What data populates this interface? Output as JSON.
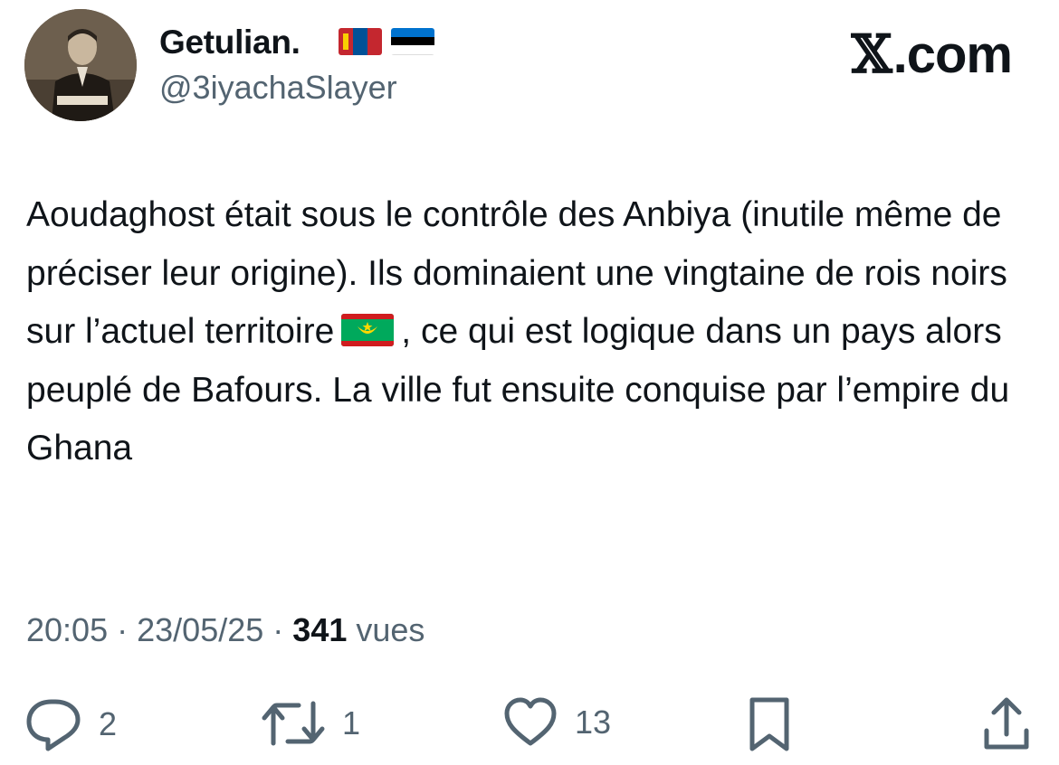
{
  "author": {
    "display_name": "Getulian.",
    "handle": "@3iyachaSlayer",
    "flags": [
      "mongolia-flag",
      "estonia-flag"
    ]
  },
  "brand": {
    "logo_x": "𝕏",
    "logo_suffix": ".com"
  },
  "tweet": {
    "text_part1": "Aoudaghost était sous le contrôle des Anbiya (inutile même de préciser leur origine). Ils dominaient une vingtaine de rois noirs sur l’actuel territoire",
    "inline_flag": "mauritania-flag",
    "text_part2": ", ce qui est logique dans un pays alors peuplé de Bafours. La ville fut ensuite conquise par l’empire du Ghana"
  },
  "meta": {
    "time": "20:05",
    "date": "23/05/25",
    "sep": "·",
    "views_count": "341",
    "views_label": "vues"
  },
  "actions": {
    "replies": "2",
    "retweets": "1",
    "likes": "13"
  },
  "colors": {
    "text": "#0f1419",
    "muted": "#536471"
  }
}
